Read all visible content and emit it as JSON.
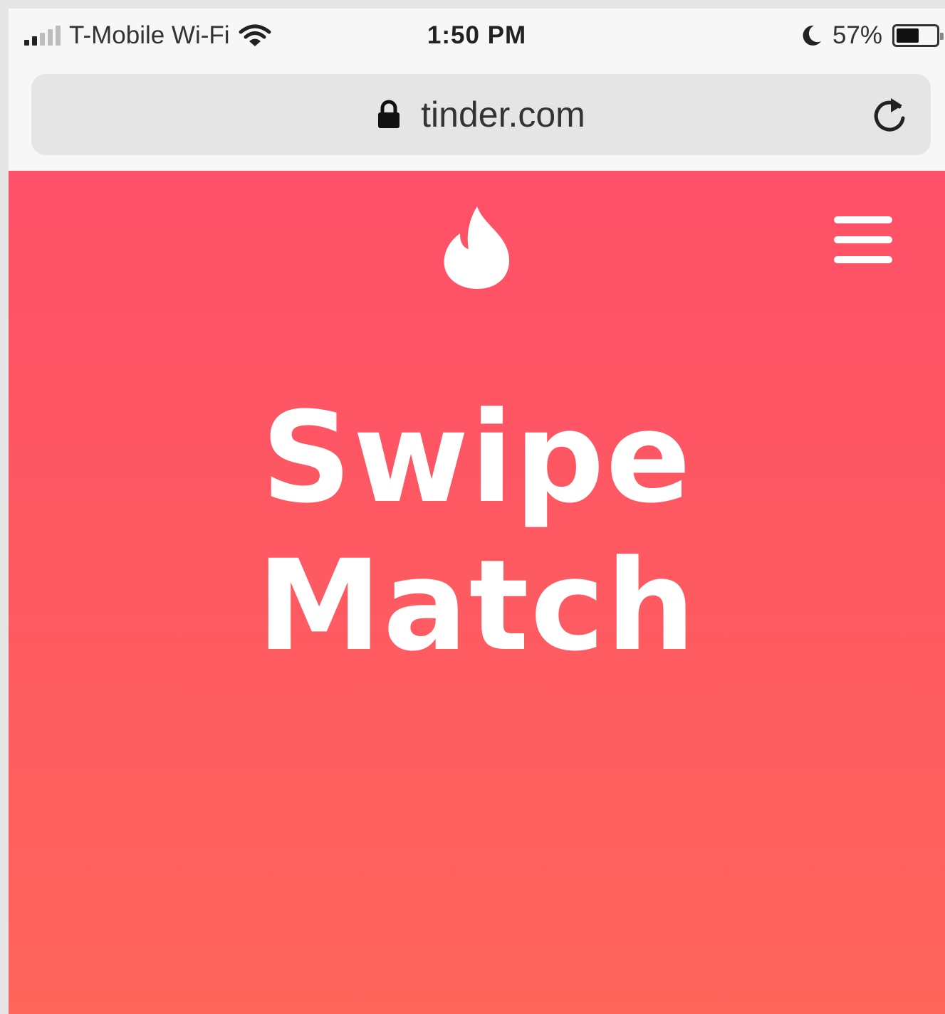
{
  "status_bar": {
    "carrier": "T-Mobile Wi-Fi",
    "time": "1:50 PM",
    "battery_percent": "57%",
    "battery_level": 0.57,
    "icons": [
      "signal-icon",
      "wifi-icon",
      "moon-icon",
      "battery-icon"
    ]
  },
  "browser": {
    "url": "tinder.com",
    "icons": [
      "lock-icon",
      "reload-icon"
    ]
  },
  "page": {
    "hero_line1": "Swipe",
    "hero_line2": "Match",
    "icons": [
      "flame-logo-icon",
      "menu-icon"
    ]
  },
  "colors": {
    "gradient_top": "#fe5068",
    "gradient_bottom": "#ff655b",
    "url_bar": "#e5e5e6",
    "chrome": "#f7f7f7"
  }
}
